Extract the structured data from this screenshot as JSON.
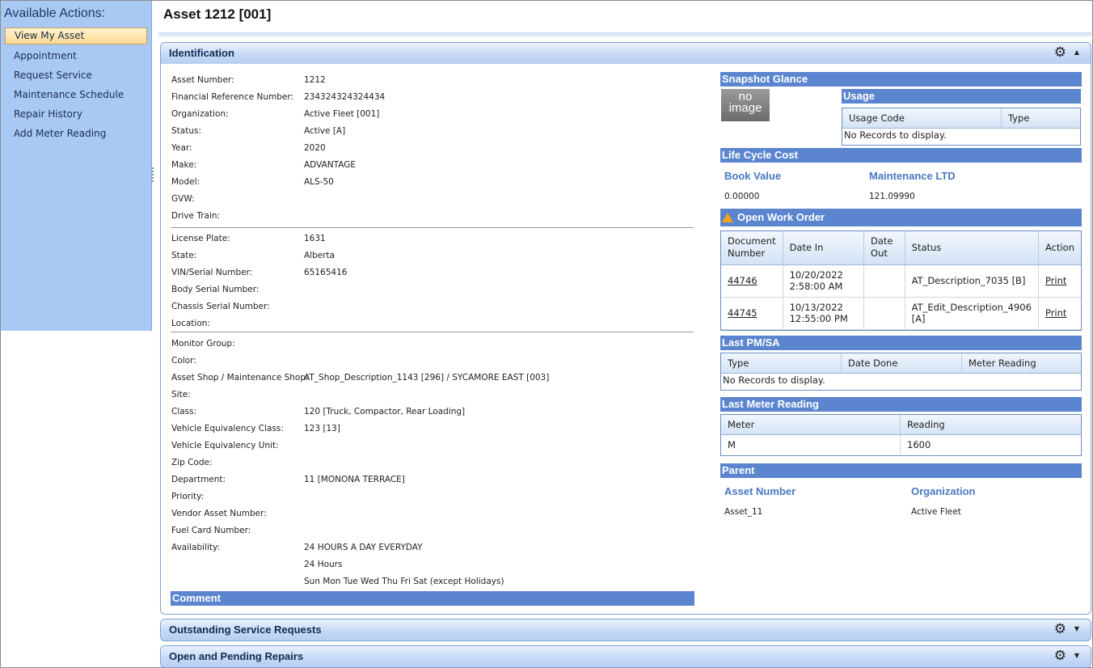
{
  "sidebar": {
    "title": "Available Actions:",
    "items": [
      {
        "label": "View My Asset",
        "active": true
      },
      {
        "label": "Appointment"
      },
      {
        "label": "Request Service"
      },
      {
        "label": "Maintenance Schedule"
      },
      {
        "label": "Repair History"
      },
      {
        "label": "Add Meter Reading"
      }
    ]
  },
  "page": {
    "title": "Asset 1212 [001]"
  },
  "identification": {
    "title": "Identification",
    "group1": [
      {
        "label": "Asset Number:",
        "value": "1212"
      },
      {
        "label": "Financial Reference Number:",
        "value": "234324324324434"
      },
      {
        "label": "Organization:",
        "value": "Active Fleet [001]"
      },
      {
        "label": "Status:",
        "value": "Active [A]"
      },
      {
        "label": "Year:",
        "value": "2020"
      },
      {
        "label": "Make:",
        "value": "ADVANTAGE"
      },
      {
        "label": "Model:",
        "value": "ALS-50"
      },
      {
        "label": "GVW:",
        "value": ""
      },
      {
        "label": "Drive Train:",
        "value": ""
      }
    ],
    "group2": [
      {
        "label": "License Plate:",
        "value": "1631"
      },
      {
        "label": "State:",
        "value": "Alberta"
      },
      {
        "label": "VIN/Serial Number:",
        "value": "65165416"
      },
      {
        "label": "Body Serial Number:",
        "value": ""
      },
      {
        "label": "Chassis Serial Number:",
        "value": ""
      },
      {
        "label": "Location:",
        "value": ""
      }
    ],
    "group3": [
      {
        "label": "Monitor Group:",
        "value": ""
      },
      {
        "label": "Color:",
        "value": ""
      },
      {
        "label": "Asset Shop / Maintenance Shop:",
        "value": "AT_Shop_Description_1143 [296] / SYCAMORE EAST [003]"
      },
      {
        "label": "Site:",
        "value": ""
      },
      {
        "label": "Class:",
        "value": "120 [Truck, Compactor, Rear Loading]"
      },
      {
        "label": "Vehicle Equivalency Class:",
        "value": "123 [13]"
      },
      {
        "label": "Vehicle Equivalency Unit:",
        "value": ""
      },
      {
        "label": "Zip Code:",
        "value": ""
      },
      {
        "label": "Department:",
        "value": "11 [MONONA TERRACE]"
      },
      {
        "label": "Priority:",
        "value": ""
      },
      {
        "label": "Vendor Asset Number:",
        "value": ""
      },
      {
        "label": "Fuel Card Number:",
        "value": ""
      },
      {
        "label": "Availability:",
        "value": "24 HOURS A DAY EVERYDAY"
      },
      {
        "label": "",
        "value": "24 Hours"
      },
      {
        "label": "",
        "value": "Sun Mon Tue Wed Thu Fri Sat (except Holidays)"
      }
    ],
    "comment_title": "Comment"
  },
  "snapshot": {
    "title": "Snapshot Glance",
    "no_image_text": "no image",
    "usage": {
      "title": "Usage",
      "columns": [
        "Usage Code",
        "Type"
      ],
      "empty": "No Records to display."
    }
  },
  "life_cycle": {
    "title": "Life Cycle Cost",
    "book_value_label": "Book Value",
    "book_value": "0.00000",
    "maint_label": "Maintenance LTD",
    "maint_value": "121.09990"
  },
  "open_work_order": {
    "title": "Open Work Order",
    "columns": [
      "Document Number",
      "Date In",
      "Date Out",
      "Status",
      "Action"
    ],
    "rows": [
      {
        "doc": "44746",
        "date_in": "10/20/2022 2:58:00 AM",
        "date_out": "",
        "status": "AT_Description_7035 [B]",
        "action": "Print"
      },
      {
        "doc": "44745",
        "date_in": "10/13/2022 12:55:00 PM",
        "date_out": "",
        "status": "AT_Edit_Description_4906 [A]",
        "action": "Print"
      }
    ]
  },
  "last_pm": {
    "title": "Last PM/SA",
    "columns": [
      "Type",
      "Date Done",
      "Meter Reading"
    ],
    "empty": "No Records to display."
  },
  "last_meter": {
    "title": "Last Meter Reading",
    "columns": [
      "Meter",
      "Reading"
    ],
    "rows": [
      {
        "meter": "M",
        "reading": "1600"
      }
    ]
  },
  "parent": {
    "title": "Parent",
    "asset_label": "Asset Number",
    "asset_value": "Asset_11",
    "org_label": "Organization",
    "org_value": "Active Fleet"
  },
  "panels": {
    "outstanding": "Outstanding Service Requests",
    "open_pending": "Open and Pending Repairs"
  },
  "icons": {
    "gear": "gear-icon",
    "collapse": "chevron-up-icon",
    "expand": "chevron-down-icon",
    "warning": "warning-icon"
  }
}
